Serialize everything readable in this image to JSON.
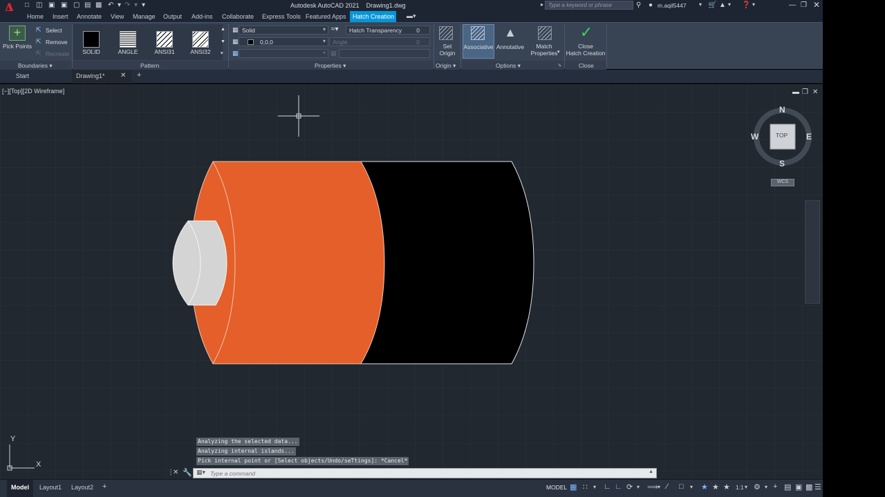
{
  "app": {
    "title": "Autodesk AutoCAD 2021",
    "document": "Drawing1.dwg",
    "search_placeholder": "Type a keyword or phrase",
    "user": "m.aqil5447"
  },
  "menu_tabs": [
    "Home",
    "Insert",
    "Annotate",
    "View",
    "Manage",
    "Output",
    "Add-ins",
    "Collaborate",
    "Express Tools",
    "Featured Apps"
  ],
  "active_tab": "Hatch Creation",
  "ribbon": {
    "boundaries": {
      "pick_points": "Pick Points",
      "select": "Select",
      "remove": "Remove",
      "recreate": "Recreate",
      "label": "Boundaries"
    },
    "pattern": {
      "items": [
        "SOLID",
        "ANGLE",
        "ANSI31",
        "ANSI32"
      ],
      "label": "Pattern"
    },
    "properties": {
      "type": "Solid",
      "color": "0,0,0",
      "transparency_label": "Hatch Transparency",
      "transparency_value": "0",
      "angle_label": "Angle",
      "angle_value": "0",
      "label": "Properties"
    },
    "origin": {
      "set_origin": "Set\nOrigin",
      "label": "Origin"
    },
    "options": {
      "associative": "Associative",
      "annotative": "Annotative",
      "match": "Match\nProperties",
      "label": "Options"
    },
    "close": {
      "button": "Close\nHatch Creation",
      "label": "Close"
    }
  },
  "doc_tabs": {
    "start": "Start",
    "drawing": "Drawing1*"
  },
  "viewport": {
    "label": "[−][Top][2D Wireframe]",
    "viewcube": {
      "top": "TOP",
      "n": "N",
      "s": "S",
      "e": "E",
      "w": "W",
      "wcs": "WCS"
    },
    "ucs": {
      "x": "X",
      "y": "Y"
    }
  },
  "command": {
    "history": [
      "Analyzing the selected data...",
      "Analyzing internal islands...",
      "Pick internal point or [Select objects/Undo/seTtings]: *Cancel*"
    ],
    "placeholder": "Type a command"
  },
  "layout_tabs": [
    "Model",
    "Layout1",
    "Layout2"
  ],
  "status": {
    "model": "MODEL",
    "scale": "1:1"
  },
  "colors": {
    "accent": "#0696d7",
    "hatch_orange": "#e45f2a",
    "canvas": "#212830",
    "ribbon": "#384354"
  }
}
